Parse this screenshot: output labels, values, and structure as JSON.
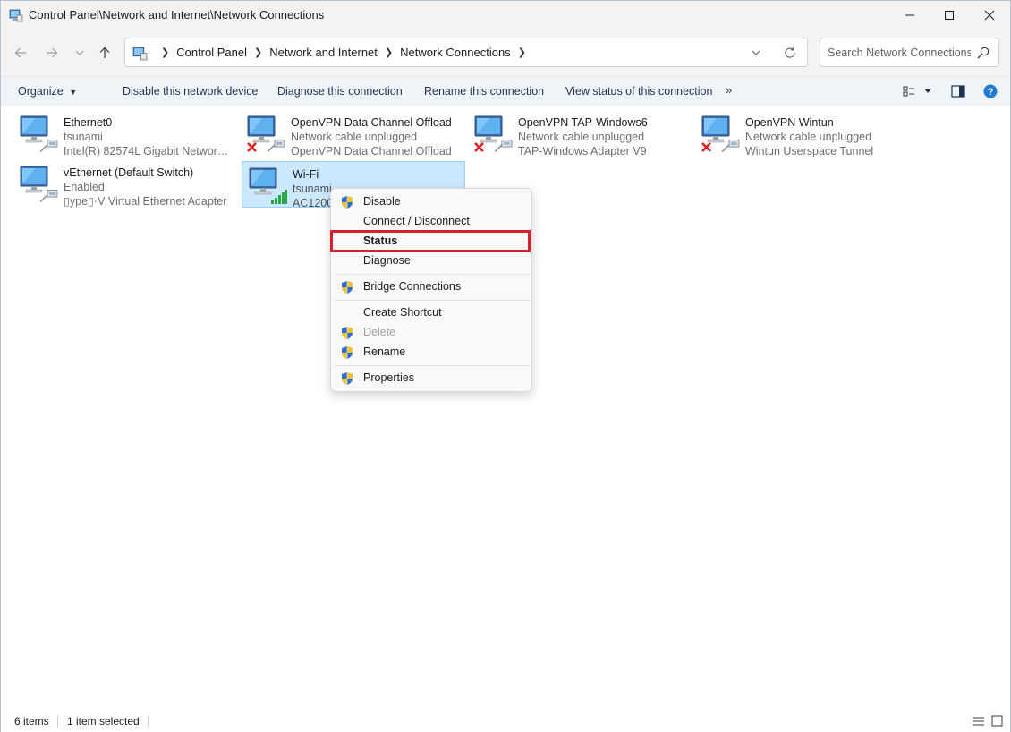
{
  "window": {
    "title": "Control Panel\\Network and Internet\\Network Connections"
  },
  "address": {
    "crumbs": [
      "Control Panel",
      "Network and Internet",
      "Network Connections"
    ],
    "search_placeholder": "Search Network Connections"
  },
  "commands": {
    "organize": "Organize",
    "disable": "Disable this network device",
    "diagnose": "Diagnose this connection",
    "rename": "Rename this connection",
    "view_status": "View status of this connection",
    "more": "»"
  },
  "connections": [
    {
      "name": "Ethernet0",
      "status": "tsunami",
      "device": "Intel(R) 82574L Gigabit Network C...",
      "icon": "ethernet-connected-icon"
    },
    {
      "name": "OpenVPN Data Channel Offload",
      "status": "Network cable unplugged",
      "device": "OpenVPN Data Channel Offload",
      "icon": "ethernet-unplugged-icon"
    },
    {
      "name": "OpenVPN TAP-Windows6",
      "status": "Network cable unplugged",
      "device": "TAP-Windows Adapter V9",
      "icon": "ethernet-unplugged-icon"
    },
    {
      "name": "OpenVPN Wintun",
      "status": "Network cable unplugged",
      "device": "Wintun Userspace Tunnel",
      "icon": "ethernet-unplugged-icon"
    },
    {
      "name": "vEthernet (Default Switch)",
      "status": "Enabled",
      "device": "▯ype▯·V Virtual Ethernet Adapter",
      "icon": "ethernet-connected-icon"
    },
    {
      "name": "Wi-Fi",
      "status": "tsunami",
      "device": "AC1200",
      "icon": "wifi-icon",
      "selected": true
    }
  ],
  "context_menu": {
    "items": [
      {
        "label": "Disable",
        "shield": true
      },
      {
        "label": "Connect / Disconnect",
        "shield": false
      },
      {
        "label": "Status",
        "shield": false,
        "bold": true
      },
      {
        "label": "Diagnose",
        "shield": false
      },
      {
        "label": "Bridge Connections",
        "shield": true
      },
      {
        "label": "Create Shortcut",
        "shield": false
      },
      {
        "label": "Delete",
        "shield": true,
        "disabled": true
      },
      {
        "label": "Rename",
        "shield": true
      },
      {
        "label": "Properties",
        "shield": true
      }
    ]
  },
  "status": {
    "items": "6 items",
    "selected": "1 item selected"
  },
  "colors": {
    "highlight_border": "#d7202c",
    "selection_bg": "#cce8ff",
    "command_bar_bg": "#eff4f9"
  }
}
